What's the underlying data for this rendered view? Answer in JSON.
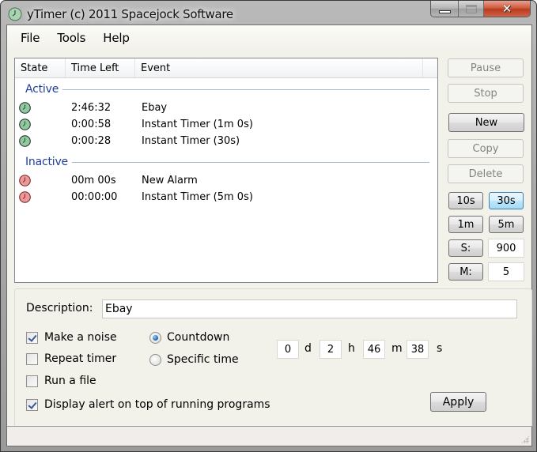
{
  "window": {
    "title": "yTimer (c) 2011 Spacejock Software",
    "app_icon": "clock-icon",
    "caption_buttons": [
      "minimize",
      "maximize",
      "close"
    ]
  },
  "menu": [
    "File",
    "Tools",
    "Help"
  ],
  "list": {
    "columns": [
      "State",
      "Time Left",
      "Event"
    ],
    "groups": [
      {
        "label": "Active",
        "rows": [
          {
            "state": "active",
            "state_icon": "green-clock-icon",
            "time_left": "2:46:32",
            "event": "Ebay"
          },
          {
            "state": "active",
            "state_icon": "green-clock-icon",
            "time_left": "0:00:58",
            "event": "Instant Timer (1m 0s)"
          },
          {
            "state": "active",
            "state_icon": "green-clock-icon",
            "time_left": "0:00:28",
            "event": "Instant Timer (30s)"
          }
        ]
      },
      {
        "label": "Inactive",
        "rows": [
          {
            "state": "inactive",
            "state_icon": "red-clock-icon",
            "time_left": "00m 00s",
            "event": "New Alarm"
          },
          {
            "state": "inactive",
            "state_icon": "red-clock-icon",
            "time_left": "00:00:00",
            "event": "Instant Timer (5m 0s)"
          }
        ]
      }
    ]
  },
  "side_buttons": {
    "pause": {
      "label": "Pause",
      "enabled": false
    },
    "stop": {
      "label": "Stop",
      "enabled": false
    },
    "new": {
      "label": "New",
      "enabled": true
    },
    "copy": {
      "label": "Copy",
      "enabled": false
    },
    "delete": {
      "label": "Delete",
      "enabled": false
    }
  },
  "quick_timers": {
    "b10s": "10s",
    "b30s": "30s",
    "b1m": "1m",
    "b5m": "5m",
    "seconds_label": "S:",
    "seconds_value": "900",
    "minutes_label": "M:",
    "minutes_value": "5"
  },
  "details": {
    "description_label": "Description:",
    "description_value": "Ebay",
    "make_noise": {
      "label": "Make a noise",
      "checked": true
    },
    "repeat_timer": {
      "label": "Repeat timer",
      "checked": false
    },
    "run_file": {
      "label": "Run a file",
      "checked": false
    },
    "display_alert": {
      "label": "Display alert on top of running programs",
      "checked": true
    },
    "mode_countdown": {
      "label": "Countdown",
      "selected": true
    },
    "mode_specific": {
      "label": "Specific time",
      "selected": false
    },
    "duration": {
      "days": "0",
      "days_unit": "d",
      "hours": "2",
      "hours_unit": "h",
      "minutes": "46",
      "minutes_unit": "m",
      "seconds": "38",
      "seconds_unit": "s"
    },
    "apply_label": "Apply"
  },
  "colors": {
    "group_header": "#1e3d9b",
    "active_clock": "#8fc9a0",
    "inactive_clock": "#e89a9a",
    "close_button": "#c8472b"
  }
}
